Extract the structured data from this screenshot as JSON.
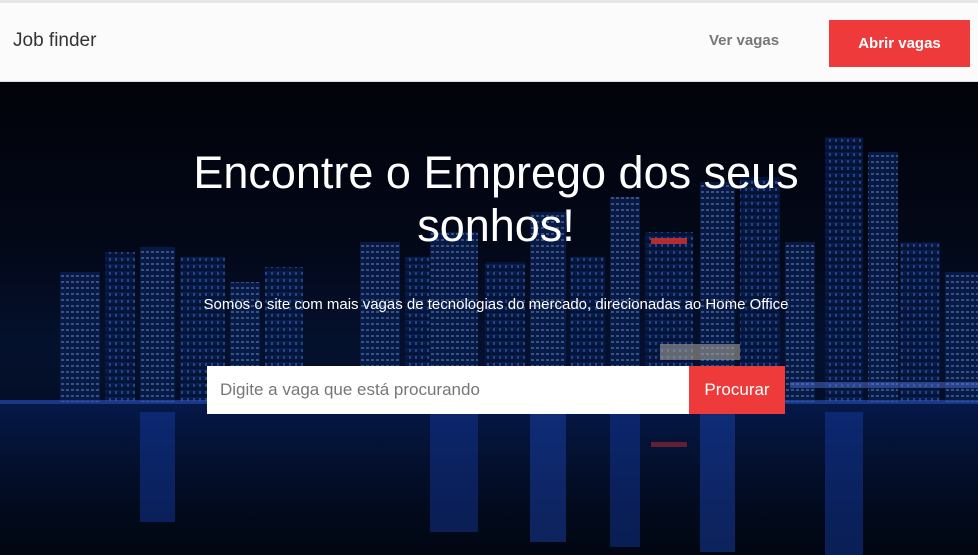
{
  "navbar": {
    "brand": "Job finder",
    "link_label": "Ver vagas",
    "button_label": "Abrir vagas"
  },
  "hero": {
    "title": "Encontre o Emprego dos seus sonhos!",
    "subtitle": "Somos o site com mais vagas de tecnologias do mercado, direcionadas ao Home Office",
    "search_placeholder": "Digite a vaga que está procurando",
    "search_button": "Procurar"
  },
  "colors": {
    "accent": "#ee3a3a",
    "navbar_bg": "#fbfbfb",
    "hero_bg": "#040a1f"
  }
}
